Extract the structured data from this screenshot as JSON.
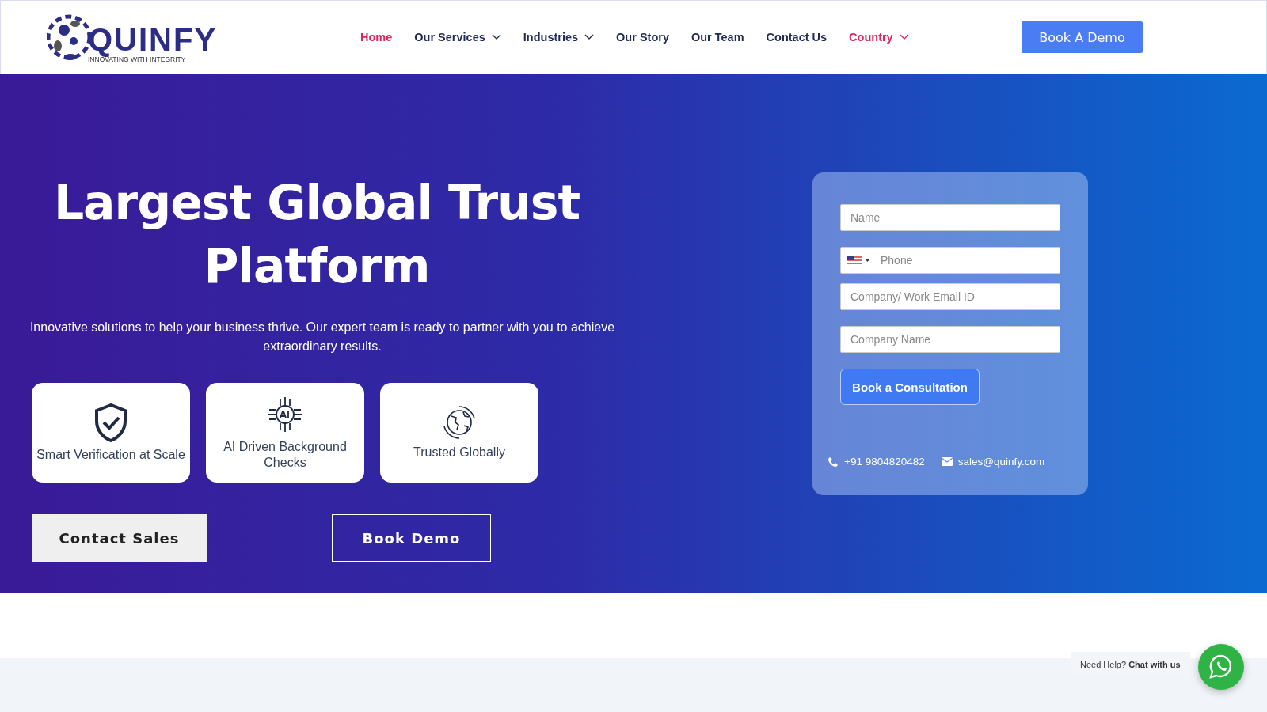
{
  "header": {
    "logo": {
      "name": "QUINFY",
      "tagline": "INNOVATING WITH INTEGRITY"
    },
    "nav": [
      {
        "label": "Home",
        "dropdown": false,
        "color": "#e0245e"
      },
      {
        "label": "Our Services",
        "dropdown": true,
        "color": "#1f2a55"
      },
      {
        "label": "Industries",
        "dropdown": true,
        "color": "#1f2a55"
      },
      {
        "label": "Our Story",
        "dropdown": false,
        "color": "#1f2a55"
      },
      {
        "label": "Our Team",
        "dropdown": false,
        "color": "#1f2a55"
      },
      {
        "label": "Contact Us",
        "dropdown": false,
        "color": "#1f2a55"
      },
      {
        "label": "Country",
        "dropdown": true,
        "color": "#e0245e"
      }
    ],
    "cta": "Book A Demo"
  },
  "hero": {
    "title": "Largest Global Trust Platform",
    "subtitle": "Innovative solutions to help your business thrive. Our expert team is ready to partner with you to achieve extraordinary results.",
    "features": [
      {
        "kind": "shield",
        "label": "Smart Verification at Scale"
      },
      {
        "kind": "ai",
        "label": "AI Driven Background Checks"
      },
      {
        "kind": "globe",
        "label": "Trusted Globally"
      }
    ],
    "buttons": [
      {
        "kind": "filled",
        "label": "Contact Sales"
      },
      {
        "kind": "outline",
        "label": "Book Demo"
      }
    ]
  },
  "form": {
    "fields": [
      {
        "kind": "text",
        "placeholder": "Name"
      },
      {
        "kind": "phone",
        "placeholder": "Phone"
      },
      {
        "kind": "text",
        "placeholder": "Company/ Work Email ID"
      },
      {
        "kind": "text",
        "placeholder": "Company Name"
      }
    ],
    "submit": "Book a Consultation",
    "phone": "+91 9804820482",
    "email": "sales@quinfy.com"
  },
  "chat": {
    "prompt": "Need Help?",
    "action": "Chat with us"
  }
}
